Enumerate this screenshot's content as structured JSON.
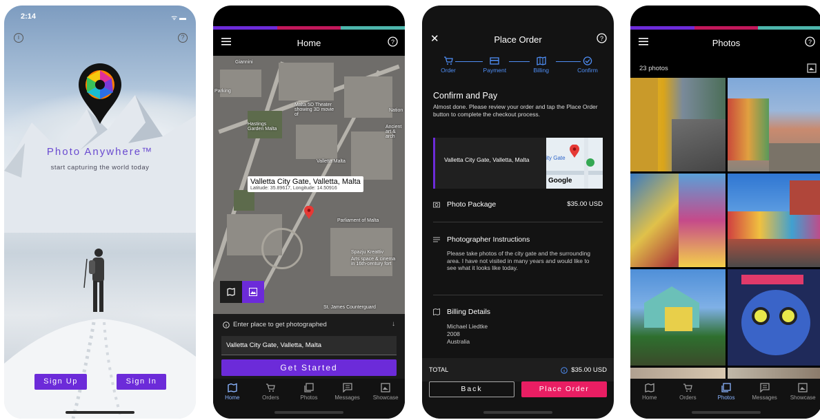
{
  "screen1": {
    "status_time": "2:14",
    "status_icons": "ᯤ ▬",
    "brand_title": "Photo Anywhere™",
    "tagline": "start capturing the world today",
    "signup_label": "Sign Up",
    "signin_label": "Sign In",
    "info_icon": "info-icon",
    "help_icon": "help-icon"
  },
  "screen2": {
    "title": "Home",
    "map_labels": [
      "Giannini",
      "Parking",
      "Hastings Garden Malta",
      "Malta 5D Theater showing 3D movie of",
      "Valletta Malta",
      "Parliament of Malta",
      "Spazju Kreattiv",
      "Arts space & cinema in 16th-century fort",
      "St. James Counterguard",
      "Nation",
      "Ancient art & arch"
    ],
    "callout_title": "Valletta City Gate, Valletta, Malta",
    "callout_sub": "Latitude: 35.89617, Longitude: 14.50916",
    "input_hint": "Enter place to get photographed",
    "input_value": "Valletta City Gate, Valletta, Malta",
    "cta_label": "Get Started",
    "tabs": [
      "Home",
      "Orders",
      "Photos",
      "Messages",
      "Showcase"
    ]
  },
  "screen3": {
    "title": "Place Order",
    "steps": [
      "Order",
      "Payment",
      "Billing",
      "Confirm"
    ],
    "heading": "Confirm and Pay",
    "intro": "Almost done. Please review your order and tap the Place Order button to complete the checkout process.",
    "location": "Valletta City Gate, Valletta, Malta",
    "mini_map_label": "ity Gate",
    "mini_map_brand": "Google",
    "package_label": "Photo Package",
    "package_price": "$35.00 USD",
    "instructions_label": "Photographer Instructions",
    "instructions_text": "Please take photos of the city gate and the surrounding area. I have not visited in many years and would like to see what it looks like today.",
    "billing_label": "Billing Details",
    "billing_name": "Michael Liedtke",
    "billing_postcode": "2008",
    "billing_country": "Australia",
    "total_label": "TOTAL",
    "total_value": "$35.00 USD",
    "back_label": "Back",
    "place_order_label": "Place Order"
  },
  "screen4": {
    "title": "Photos",
    "count": "23 photos",
    "tabs": [
      "Home",
      "Orders",
      "Photos",
      "Messages",
      "Showcase"
    ],
    "active_tab": "Photos"
  },
  "colors": {
    "purple": "#6c2bd9",
    "pink": "#e91e63",
    "teal": "#4db6ac",
    "magenta": "#c2185b",
    "blue": "#4f8ff7"
  }
}
